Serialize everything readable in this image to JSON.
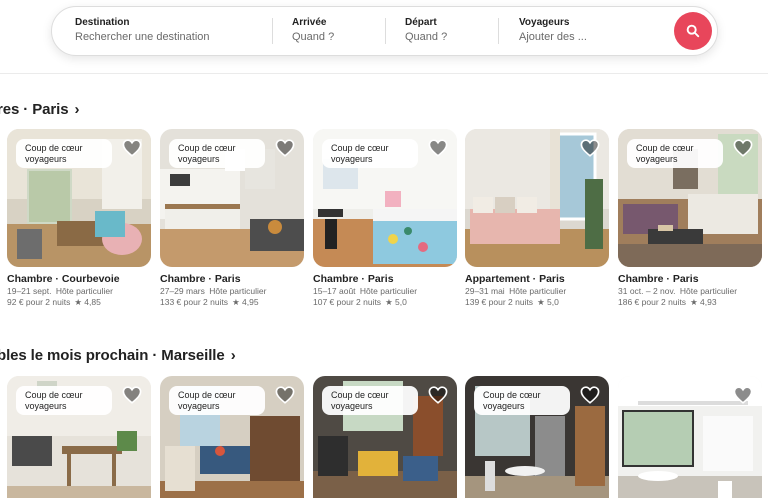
{
  "search": {
    "destination_label": "Destination",
    "destination_placeholder": "Rechercher une destination",
    "arrival_label": "Arrivée",
    "arrival_value": "Quand ?",
    "departure_label": "Départ",
    "departure_value": "Quand ?",
    "travelers_label": "Voyageurs",
    "travelers_value": "Ajouter des ...",
    "button_icon": "search-icon",
    "accent_color": "#e8465b"
  },
  "sections": [
    {
      "title": "res · Paris",
      "chevron": "›",
      "cards": [
        {
          "badge": "Coup de cœur voyageurs",
          "title": "Chambre · Courbevoie",
          "dates": "19–21 sept.",
          "host": "Hôte particulier",
          "price": "92 € pour 2 nuits",
          "rating": "★ 4,85"
        },
        {
          "badge": "Coup de cœur voyageurs",
          "title": "Chambre · Paris",
          "dates": "27–29 mars",
          "host": "Hôte particulier",
          "price": "133 € pour 2 nuits",
          "rating": "★ 4,95"
        },
        {
          "badge": "Coup de cœur voyageurs",
          "title": "Chambre · Paris",
          "dates": "15–17 août",
          "host": "Hôte particulier",
          "price": "107 € pour 2 nuits",
          "rating": "★ 5,0"
        },
        {
          "badge": "",
          "title": "Appartement · Paris",
          "dates": "29–31 mai",
          "host": "Hôte particulier",
          "price": "139 € pour 2 nuits",
          "rating": "★ 5,0"
        },
        {
          "badge": "Coup de cœur voyageurs",
          "title": "Chambre · Paris",
          "dates": "31 oct. – 2 nov.",
          "host": "Hôte particulier",
          "price": "186 € pour 2 nuits",
          "rating": "★ 4,93"
        }
      ]
    },
    {
      "title": "bles le mois prochain · Marseille",
      "chevron": "›",
      "cards": [
        {
          "badge": "Coup de cœur voyageurs"
        },
        {
          "badge": "Coup de cœur voyageurs"
        },
        {
          "badge": "Coup de cœur voyageurs"
        },
        {
          "badge": "Coup de cœur voyageurs"
        },
        {
          "badge": ""
        }
      ]
    }
  ]
}
